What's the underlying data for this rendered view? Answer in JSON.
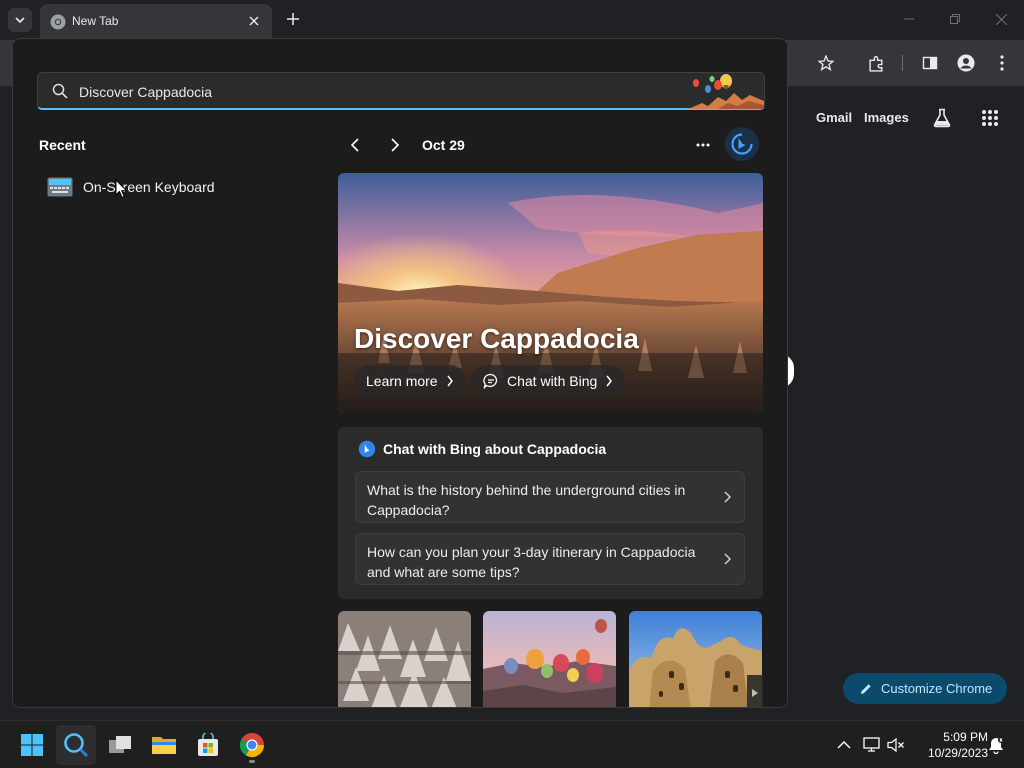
{
  "tab": {
    "title": "New Tab"
  },
  "page": {
    "gmail": "Gmail",
    "images": "Images",
    "customize": "Customize Chrome"
  },
  "search": {
    "query": "Discover Cappadocia"
  },
  "recent": {
    "heading": "Recent",
    "items": [
      {
        "label": "On-Screen Keyboard",
        "icon": "keyboard-icon"
      }
    ]
  },
  "highlights": {
    "date": "Oct 29",
    "hero": {
      "title": "Discover Cappadocia",
      "learn_more": "Learn more",
      "chat_with_bing": "Chat with Bing"
    },
    "chat": {
      "heading": "Chat with Bing about Cappadocia",
      "questions": [
        "What is the history behind the underground cities in Cappadocia?",
        "How can you plan your 3-day itinerary in Cappadocia and what are some tips?"
      ]
    },
    "thumbnails": [
      "fairy-chimneys",
      "hot-air-balloons",
      "cave-dwellings"
    ]
  },
  "taskbar": {
    "apps": [
      "start-icon",
      "search-icon",
      "task-view-icon",
      "file-explorer-icon",
      "microsoft-store-icon",
      "chrome-icon"
    ],
    "time": "5:09 PM",
    "date": "10/29/2023"
  },
  "colors": {
    "accent": "#4cc2ff",
    "flyout_bg": "#1c1c1c",
    "card_bg": "#2b2b2b",
    "customize_bg": "#0b4a6b"
  }
}
